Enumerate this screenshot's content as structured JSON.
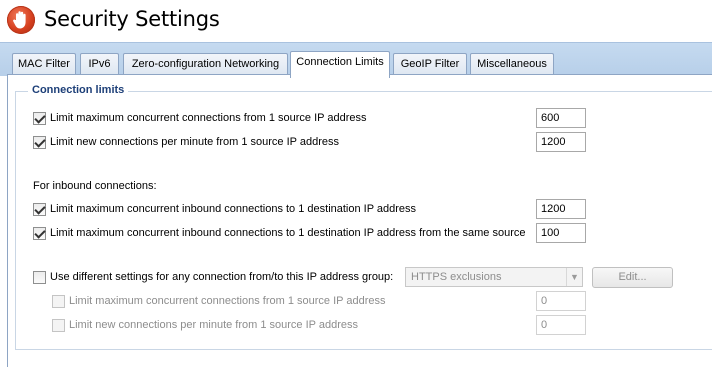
{
  "window": {
    "title": "Security Settings"
  },
  "tabs": [
    {
      "label": "MAC Filter"
    },
    {
      "label": "IPv6"
    },
    {
      "label": "Zero-configuration Networking"
    },
    {
      "label": "Connection Limits"
    },
    {
      "label": "GeoIP Filter"
    },
    {
      "label": "Miscellaneous"
    }
  ],
  "active_tab": "Connection Limits",
  "group": {
    "title": "Connection limits",
    "rows": [
      {
        "label": "Limit maximum concurrent connections from 1 source IP address",
        "checked": true,
        "value": "600"
      },
      {
        "label": "Limit new connections per minute from 1 source IP address",
        "checked": true,
        "value": "1200"
      }
    ],
    "inbound_heading": "For inbound connections:",
    "inbound_rows": [
      {
        "label": "Limit maximum concurrent inbound connections to 1 destination IP address",
        "checked": true,
        "value": "1200"
      },
      {
        "label": "Limit maximum concurrent inbound connections to 1 destination IP address from the same source",
        "checked": true,
        "value": "100"
      }
    ],
    "group_settings": {
      "label": "Use different settings for any connection from/to this IP address group:",
      "checked": false,
      "selected_group": "HTTPS exclusions",
      "edit_label": "Edit...",
      "sub_rows": [
        {
          "label": "Limit maximum concurrent connections from 1 source IP address",
          "checked": false,
          "value": "0"
        },
        {
          "label": "Limit new connections per minute from 1 source IP address",
          "checked": false,
          "value": "0"
        }
      ]
    }
  },
  "icons": {
    "app": "hand-stop-icon",
    "dropdown": "chevron-down-icon"
  },
  "colors": {
    "accent": "#1d3f78",
    "tabstrip": "#c5daf0",
    "icon": "#d6401f"
  }
}
